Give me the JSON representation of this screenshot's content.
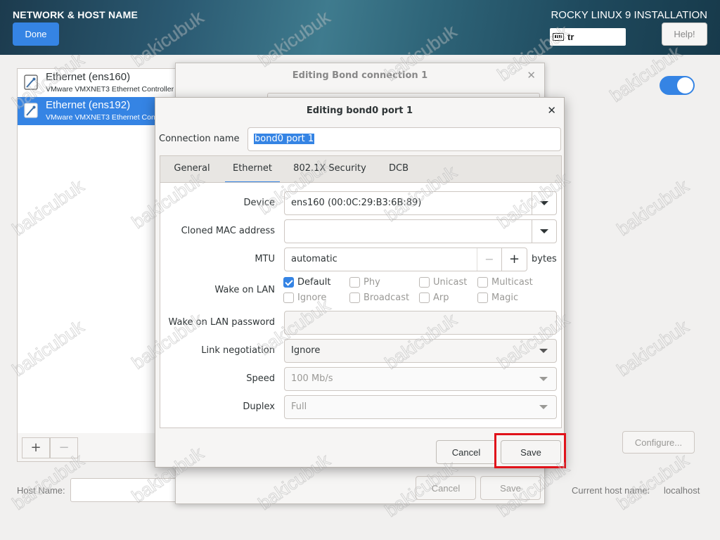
{
  "header": {
    "title": "NETWORK & HOST NAME",
    "done_label": "Done",
    "distro": "ROCKY LINUX 9 INSTALLATION",
    "keyboard_layout": "tr",
    "help_label": "Help!"
  },
  "connections": [
    {
      "name": "Ethernet (ens160)",
      "desc": "VMware VMXNET3 Ethernet Controller",
      "selected": false
    },
    {
      "name": "Ethernet (ens192)",
      "desc": "VMware VMXNET3 Ethernet Controller",
      "selected": true
    }
  ],
  "list_toolbar": {
    "add": "+",
    "remove": "−"
  },
  "configure_label": "Configure...",
  "hostname": {
    "label": "Host Name:",
    "value": "",
    "current_label": "Current host name:",
    "current_value": "localhost"
  },
  "bg_dialog": {
    "title": "Editing Bond connection 1",
    "cancel": "Cancel",
    "save": "Save"
  },
  "dialog": {
    "title": "Editing bond0 port 1",
    "connection_name_label": "Connection name",
    "connection_name_value": "bond0 port 1",
    "tabs": [
      "General",
      "Ethernet",
      "802.1X Security",
      "DCB"
    ],
    "active_tab": "Ethernet",
    "fields": {
      "device_label": "Device",
      "device_value": "ens160 (00:0C:29:B3:6B:89)",
      "cloned_mac_label": "Cloned MAC address",
      "cloned_mac_value": "",
      "mtu_label": "MTU",
      "mtu_value": "automatic",
      "mtu_unit": "bytes",
      "wol_label": "Wake on LAN",
      "wol_options": [
        {
          "label": "Default",
          "checked": true
        },
        {
          "label": "Phy",
          "checked": false
        },
        {
          "label": "Unicast",
          "checked": false
        },
        {
          "label": "Multicast",
          "checked": false
        },
        {
          "label": "Ignore",
          "checked": false
        },
        {
          "label": "Broadcast",
          "checked": false
        },
        {
          "label": "Arp",
          "checked": false
        },
        {
          "label": "Magic",
          "checked": false
        }
      ],
      "wol_password_label": "Wake on LAN password",
      "wol_password_value": "",
      "link_negotiation_label": "Link negotiation",
      "link_negotiation_value": "Ignore",
      "speed_label": "Speed",
      "speed_value": "100 Mb/s",
      "duplex_label": "Duplex",
      "duplex_value": "Full"
    },
    "cancel_label": "Cancel",
    "save_label": "Save"
  },
  "watermark": "bakicubuk",
  "colors": {
    "accent": "#3584e4",
    "highlight": "#e0121a"
  }
}
